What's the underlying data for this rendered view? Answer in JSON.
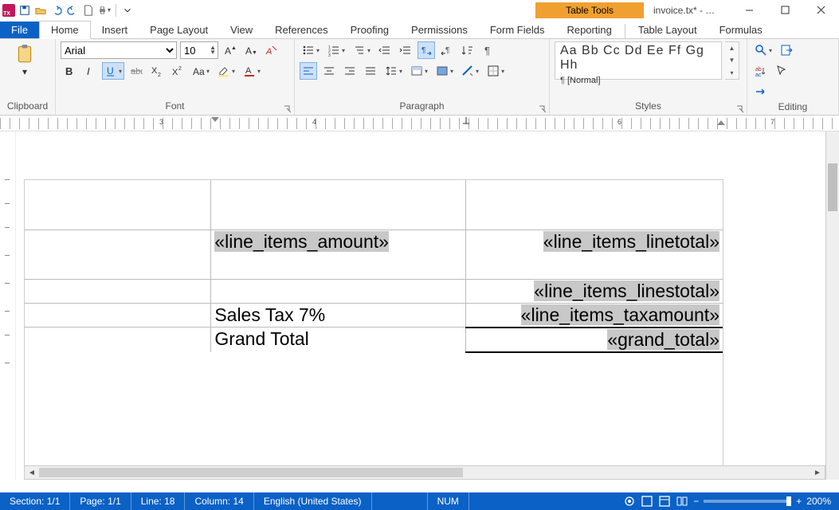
{
  "window": {
    "title": "invoice.tx* - T...",
    "context_tab": "Table Tools"
  },
  "tabs": {
    "file": "File",
    "home": "Home",
    "insert": "Insert",
    "page_layout": "Page Layout",
    "view": "View",
    "references": "References",
    "proofing": "Proofing",
    "permissions": "Permissions",
    "form_fields": "Form Fields",
    "reporting": "Reporting",
    "table_layout": "Table Layout",
    "formulas": "Formulas"
  },
  "ribbon": {
    "clipboard": {
      "label": "Clipboard",
      "paste": "Paste"
    },
    "font": {
      "label": "Font",
      "name": "Arial",
      "size": "10"
    },
    "paragraph": {
      "label": "Paragraph"
    },
    "styles": {
      "label": "Styles",
      "preview": "Aa Bb Cc Dd Ee Ff Gg Hh",
      "name": "[Normal]"
    },
    "editing": {
      "label": "Editing"
    }
  },
  "ruler": {
    "n1": "3",
    "n2": "4",
    "n3": "6",
    "n4": "7"
  },
  "doc": {
    "r1c2": "«line_items_amount»",
    "r1c3": "«line_items_linetotal»",
    "r2c3": "«line_items_linestotal»",
    "r3c2": "Sales Tax 7%",
    "r3c3": "«line_items_taxamount»",
    "r4c2": "Grand Total",
    "r4c3": "«grand_total»"
  },
  "status": {
    "section": "Section: 1/1",
    "page": "Page: 1/1",
    "line": "Line: 18",
    "column": "Column: 14",
    "lang": "English (United States)",
    "num": "NUM",
    "zoom": "200%"
  }
}
